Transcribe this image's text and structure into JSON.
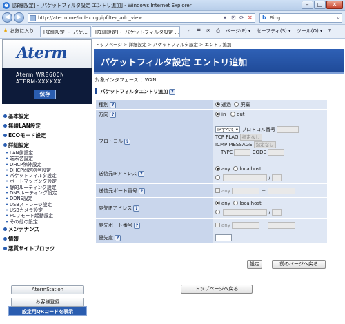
{
  "browser": {
    "window_title": "[詳細設定] - [パケットフィルタ設定 エントリ追加] - Windows Internet Explorer",
    "url": "http://aterm.me/index.cgi/ipfilter_add_view",
    "search_placeholder": "Bing",
    "favorites_label": "お気に入り",
    "tab1": "[詳細設定] - [パケ...",
    "tab2": "[詳細設定] - [パケットフィルタ設定 ...",
    "cmd_page": "ページ(P) ▾",
    "cmd_safety": "セーフティ(S) ▾",
    "cmd_tools": "ツール(O) ▾"
  },
  "sidebar": {
    "logo": "Aterm",
    "model_line1": "Aterm WR8600N",
    "model_line2": "ATERM-XXXXXX",
    "save_label": "保存",
    "menu": [
      {
        "label": "基本設定",
        "type": "head"
      },
      {
        "label": "無線LAN設定",
        "type": "head"
      },
      {
        "label": "ECOモード設定",
        "type": "head"
      },
      {
        "label": "詳細設定",
        "type": "head"
      },
      {
        "label": "LAN側設定",
        "type": "sub"
      },
      {
        "label": "端末名設定",
        "type": "sub"
      },
      {
        "label": "DHCP除外設定",
        "type": "sub"
      },
      {
        "label": "DHCP固定割当設定",
        "type": "sub"
      },
      {
        "label": "パケットフィルタ設定",
        "type": "sub"
      },
      {
        "label": "ポートマッピング設定",
        "type": "sub"
      },
      {
        "label": "静的ルーティング設定",
        "type": "sub"
      },
      {
        "label": "DNSルーティング設定",
        "type": "sub"
      },
      {
        "label": "DDNS設定",
        "type": "sub"
      },
      {
        "label": "USBストレージ設定",
        "type": "sub"
      },
      {
        "label": "USBカメラ設定",
        "type": "sub"
      },
      {
        "label": "PCリモート起動設定",
        "type": "sub"
      },
      {
        "label": "その他の設定",
        "type": "sub"
      },
      {
        "label": "メンテナンス",
        "type": "head"
      },
      {
        "label": "情報",
        "type": "head"
      },
      {
        "label": "悪質サイトブロック",
        "type": "head"
      }
    ],
    "qr_label": "設定用QRコードを表示",
    "atermstation_label": "AtermStation",
    "support_label": "お客様登録"
  },
  "main": {
    "breadcrumb": "トップページ > 詳細設定 > パケットフィルタ設定 > エントリ追加",
    "title": "パケットフィルタ設定 エントリ追加",
    "interface_line": "対象インタフェース ：WAN",
    "section_title": "パケットフィルタエントリ追加",
    "rows": {
      "kind": {
        "label": "種別",
        "opt1": "通過",
        "opt2": "廃棄"
      },
      "direction": {
        "label": "方向",
        "opt1": "in",
        "opt2": "out"
      },
      "protocol": {
        "label": "プロトコル",
        "select": "IPすべて ▾",
        "protno_label": "プロトコル番号",
        "tcpflag_label": "TCP FLAG",
        "tcpflag_value": "指定なし",
        "icmp_label": "ICMP MESSAGE",
        "icmp_value": "指定なし",
        "type_label": "TYPE",
        "code_label": "CODE"
      },
      "src_ip": {
        "label": "送信元IPアドレス",
        "opt1": "any",
        "opt2": "localhost",
        "slash": "/"
      },
      "src_port": {
        "label": "送信元ポート番号",
        "any": "any",
        "dash": "－"
      },
      "dst_ip": {
        "label": "宛先IPアドレス",
        "opt1": "any",
        "opt2": "localhost",
        "slash": "/"
      },
      "dst_port": {
        "label": "宛先ポート番号",
        "any": "any",
        "dash": "－"
      },
      "priority": {
        "label": "優先度"
      }
    },
    "set_label": "設定",
    "back_label": "前のページへ戻る",
    "top_label": "トップページへ戻る"
  }
}
